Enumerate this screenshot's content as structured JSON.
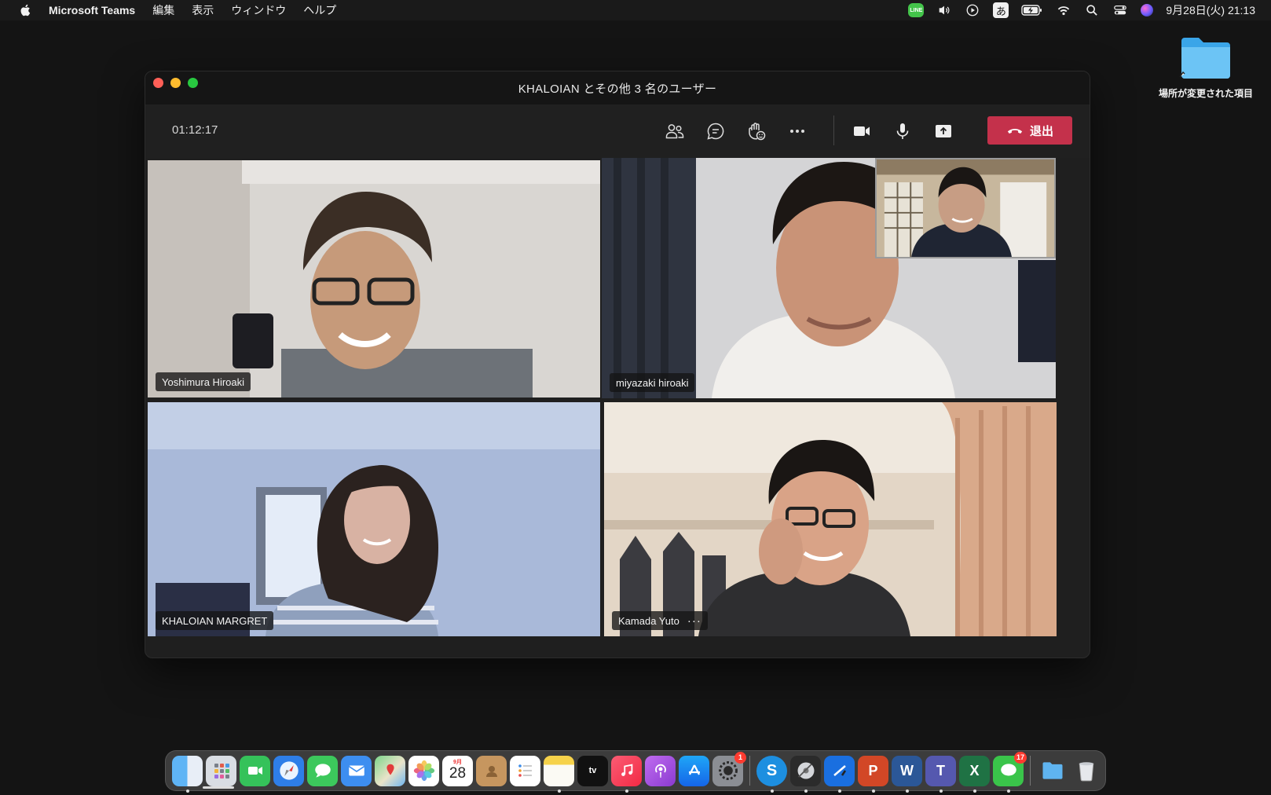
{
  "menubar": {
    "app_name": "Microsoft Teams",
    "menus": [
      "編集",
      "表示",
      "ウィンドウ",
      "ヘルプ"
    ],
    "status_icons": [
      "line-icon",
      "volume-icon",
      "play-icon",
      "input-method-icon",
      "battery-icon",
      "wifi-icon",
      "spotlight-icon",
      "control-center-icon",
      "siri-icon"
    ],
    "ime_label": "あ",
    "line_label": "LINE",
    "clock": "9月28日(火)  21:13"
  },
  "desktop": {
    "folder_label": "場所が変更された項目"
  },
  "window": {
    "title": "KHALOIAN とその他 3 名のユーザー",
    "timer": "01:12:17",
    "leave_label": "退出"
  },
  "participants": [
    {
      "name": "Yoshimura Hiroaki",
      "active": true
    },
    {
      "name": "miyazaki hiroaki",
      "active": false
    },
    {
      "name": "KHALOIAN MARGRET",
      "active": true
    },
    {
      "name": "Kamada Yuto",
      "active": true,
      "more": "···"
    }
  ],
  "dock": {
    "apps": [
      "Finder",
      "Launchpad",
      "FaceTime",
      "Safari",
      "Messages",
      "Mail",
      "Maps",
      "Photos",
      "Calendar",
      "Contacts",
      "Reminders",
      "Notes",
      "TV",
      "Music",
      "Podcasts",
      "App Store",
      "System Preferences",
      "Skype",
      "Disk Utility",
      "Xcode",
      "PowerPoint",
      "Word",
      "Teams",
      "Excel",
      "LINE",
      "Folder",
      "Trash"
    ],
    "calendar_month": "9月",
    "calendar_day": "28",
    "tv_label": "tv",
    "system_prefs_badge": "1",
    "line_badge": "17",
    "skype_letter": "S",
    "word_letter": "W",
    "excel_letter": "X",
    "powerpoint_letter": "P",
    "teams_letter": "T"
  }
}
